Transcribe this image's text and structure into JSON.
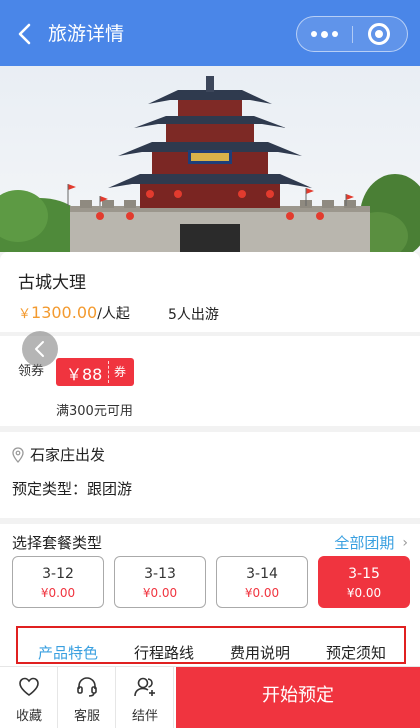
{
  "header": {
    "title": "旅游详情",
    "back_icon": "back-arrow-icon",
    "more_icon": "more-dots-icon",
    "close_icon": "capsule-close-icon",
    "bg_color": "#4a86e8"
  },
  "product": {
    "name": "古城大理",
    "currency": "￥",
    "price": "1300.00",
    "unit": "/人起",
    "people": "5人出游"
  },
  "coupon": {
    "label": "领券",
    "amount": "￥88",
    "tag": "券",
    "condition": "满300元可用",
    "color": "#f0343f"
  },
  "departure": {
    "icon": "location-pin-icon",
    "from": "石家庄出发",
    "booking_type": "预定类型：跟团游"
  },
  "packages": {
    "title": "选择套餐类型",
    "all_link": "全部团期",
    "items": [
      {
        "date": "3-12",
        "price": "¥0.00",
        "selected": false
      },
      {
        "date": "3-13",
        "price": "¥0.00",
        "selected": false
      },
      {
        "date": "3-14",
        "price": "¥0.00",
        "selected": false
      },
      {
        "date": "3-15",
        "price": "¥0.00",
        "selected": true
      }
    ]
  },
  "tabs": [
    "产品特色",
    "行程路线",
    "费用说明",
    "预定须知"
  ],
  "active_tab": 0,
  "bottom_bar": {
    "favorite": "收藏",
    "service": "客服",
    "companion": "结伴",
    "book_button": "开始预定"
  },
  "colors": {
    "accent_blue": "#3aa0e0",
    "price_orange": "#f39a2f",
    "brand_red": "#f0343f"
  }
}
